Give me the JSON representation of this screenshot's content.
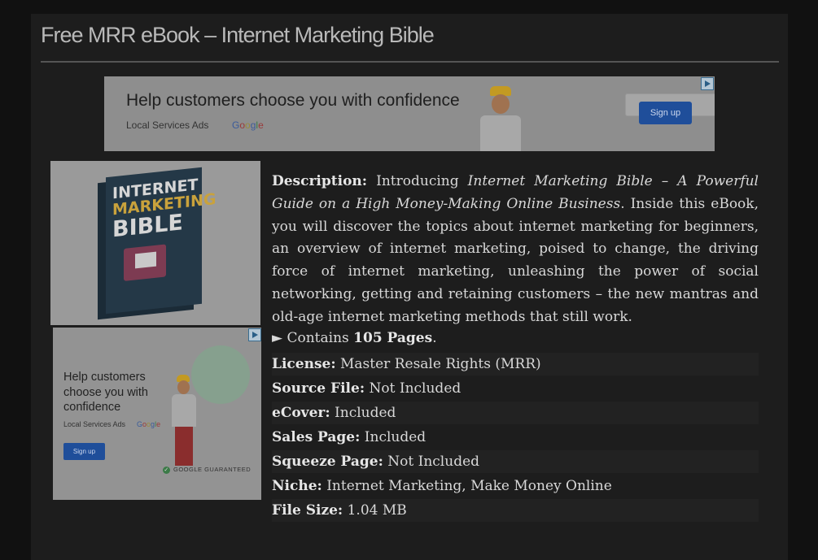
{
  "page": {
    "title": "Free MRR eBook – Internet Marketing Bible"
  },
  "banner_ad": {
    "headline": "Help customers choose you with confidence",
    "sub": "Local Services Ads",
    "brand": "Google",
    "signup_label": "Sign up"
  },
  "cover": {
    "word1": "INTERNET",
    "word2": "MARKETING",
    "word3": "BIBLE"
  },
  "side_ad": {
    "headline": "Help customers choose you with confidence",
    "sub": "Local Services Ads",
    "brand": "Google",
    "signup_label": "Sign up",
    "guarantee": "GOOGLE GUARANTEED"
  },
  "description": {
    "label": "Description:",
    "intro": "Introducing",
    "title_italic": "Internet Marketing Bible – A Powerful Guide on a High Money-Making Online Business",
    "body": ". Inside this eBook, you will discover the topics about internet marketing for beginners, an overview of internet marketing, poised to change, the driving force of internet marketing, unleashing the power of social networking, getting and retaining customers – the new mantras and old-age internet marketing methods that still work."
  },
  "contains": {
    "prefix": "► Contains",
    "pages": "105 Pages",
    "suffix": "."
  },
  "specs": [
    {
      "label": "License:",
      "value": "Master Resale Rights (MRR)"
    },
    {
      "label": "Source File:",
      "value": "Not Included"
    },
    {
      "label": "eCover:",
      "value": "Included"
    },
    {
      "label": "Sales Page:",
      "value": "Included"
    },
    {
      "label": "Squeeze Page:",
      "value": "Not Included"
    },
    {
      "label": "Niche:",
      "value": "Internet Marketing, Make Money Online"
    },
    {
      "label": "File Size:",
      "value": "1.04 MB"
    }
  ],
  "colors": {
    "page_bg": "#111111",
    "panel_bg": "#1d1d1d",
    "text": "#d8d8d8",
    "button": "#1f4e9a"
  }
}
